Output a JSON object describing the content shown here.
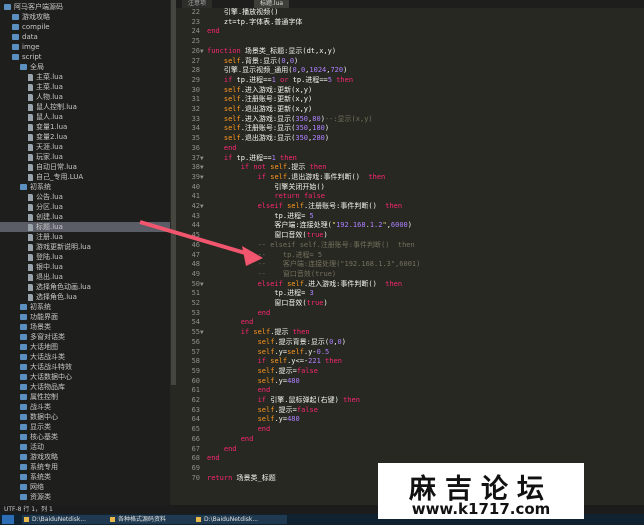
{
  "tabs": [
    "注意项",
    "标题.lua"
  ],
  "sidebar": {
    "items": [
      {
        "label": "阿马客户端源码",
        "type": "folder",
        "depth": 0
      },
      {
        "label": "游戏攻略",
        "type": "folder",
        "depth": 1
      },
      {
        "label": "compile",
        "type": "folder",
        "depth": 1
      },
      {
        "label": "data",
        "type": "folder",
        "depth": 1
      },
      {
        "label": "imge",
        "type": "folder",
        "depth": 1
      },
      {
        "label": "script",
        "type": "folder",
        "depth": 1
      },
      {
        "label": "全局",
        "type": "folder",
        "depth": 2
      },
      {
        "label": "主菜.lua",
        "type": "file",
        "depth": 3
      },
      {
        "label": "主菜.lua",
        "type": "file",
        "depth": 3
      },
      {
        "label": "人物.lua",
        "type": "file",
        "depth": 3
      },
      {
        "label": "鼠人控制.lua",
        "type": "file",
        "depth": 3
      },
      {
        "label": "鼠人.lua",
        "type": "file",
        "depth": 3
      },
      {
        "label": "变量1.lua",
        "type": "file",
        "depth": 3
      },
      {
        "label": "变量2.lua",
        "type": "file",
        "depth": 3
      },
      {
        "label": "天涯.lua",
        "type": "file",
        "depth": 3
      },
      {
        "label": "玩家.lua",
        "type": "file",
        "depth": 3
      },
      {
        "label": "自动日常.lua",
        "type": "file",
        "depth": 3
      },
      {
        "label": "自己_专用.LUA",
        "type": "file",
        "depth": 3
      },
      {
        "label": "初系统",
        "type": "folder",
        "depth": 2
      },
      {
        "label": "公告.lua",
        "type": "file",
        "depth": 3
      },
      {
        "label": "分区.lua",
        "type": "file",
        "depth": 3
      },
      {
        "label": "创建.lua",
        "type": "file",
        "depth": 3
      },
      {
        "label": "标题.lua",
        "type": "file",
        "depth": 3,
        "selected": true
      },
      {
        "label": "注册.lua",
        "type": "file",
        "depth": 3
      },
      {
        "label": "游戏更新说明.lua",
        "type": "file",
        "depth": 3
      },
      {
        "label": "登陆.lua",
        "type": "file",
        "depth": 3
      },
      {
        "label": "银中.lua",
        "type": "file",
        "depth": 3
      },
      {
        "label": "退出.lua",
        "type": "file",
        "depth": 3
      },
      {
        "label": "选择角色动画.lua",
        "type": "file",
        "depth": 3
      },
      {
        "label": "选择角色.lua",
        "type": "file",
        "depth": 3
      },
      {
        "label": "初系统",
        "type": "folder",
        "depth": 2
      },
      {
        "label": "功能界面",
        "type": "folder",
        "depth": 2
      },
      {
        "label": "场景类",
        "type": "folder",
        "depth": 2
      },
      {
        "label": "多窗对话类",
        "type": "folder",
        "depth": 2
      },
      {
        "label": "大话地图",
        "type": "folder",
        "depth": 2
      },
      {
        "label": "大话战斗类",
        "type": "folder",
        "depth": 2
      },
      {
        "label": "大话战斗特效",
        "type": "folder",
        "depth": 2
      },
      {
        "label": "大话数据中心",
        "type": "folder",
        "depth": 2
      },
      {
        "label": "大话物品库",
        "type": "folder",
        "depth": 2
      },
      {
        "label": "属性控制",
        "type": "folder",
        "depth": 2
      },
      {
        "label": "战斗类",
        "type": "folder",
        "depth": 2
      },
      {
        "label": "数据中心",
        "type": "folder",
        "depth": 2
      },
      {
        "label": "显示类",
        "type": "folder",
        "depth": 2
      },
      {
        "label": "核心基类",
        "type": "folder",
        "depth": 2
      },
      {
        "label": "活动",
        "type": "folder",
        "depth": 2
      },
      {
        "label": "游戏攻略",
        "type": "folder",
        "depth": 2
      },
      {
        "label": "系统专用",
        "type": "folder",
        "depth": 2
      },
      {
        "label": "系统类",
        "type": "folder",
        "depth": 2
      },
      {
        "label": "网络",
        "type": "folder",
        "depth": 2
      },
      {
        "label": "资源类",
        "type": "folder",
        "depth": 2
      }
    ]
  },
  "code": {
    "lines": [
      {
        "n": "22",
        "t": "    引擎.播放视频()"
      },
      {
        "n": "23",
        "t": "    zt=tp.字体表.普通字体"
      },
      {
        "n": "24",
        "t": "end"
      },
      {
        "n": "25",
        "t": ""
      },
      {
        "n": "26",
        "t": "function 场景类_标题:显示(dt,x,y)",
        "fold": true
      },
      {
        "n": "27",
        "t": "    self.背景:显示(0,0)"
      },
      {
        "n": "28",
        "t": "    引擎.显示视频_通用(0,0,1024,720)"
      },
      {
        "n": "29",
        "t": "    if tp.进程==1 or tp.进程==5 then"
      },
      {
        "n": "30",
        "t": "    self.进入游戏:更新(x,y)"
      },
      {
        "n": "31",
        "t": "    self.注册账号:更新(x,y)"
      },
      {
        "n": "32",
        "t": "    self.退出游戏:更新(x,y)"
      },
      {
        "n": "33",
        "t": "    self.进入游戏:显示(350,80)--:显示(x,y)"
      },
      {
        "n": "34",
        "t": "    self.注册账号:显示(350,180)"
      },
      {
        "n": "35",
        "t": "    self.退出游戏:显示(350,280)"
      },
      {
        "n": "36",
        "t": "    end"
      },
      {
        "n": "37",
        "t": "    if tp.进程==1 then",
        "fold": true
      },
      {
        "n": "38",
        "t": "        if not self.提示 then",
        "fold": true
      },
      {
        "n": "39",
        "t": "            if self.退出游戏:事件判断()  then",
        "fold": true
      },
      {
        "n": "40",
        "t": "                引擎关闭开始()"
      },
      {
        "n": "41",
        "t": "                return false"
      },
      {
        "n": "42",
        "t": "            elseif self.注册账号:事件判断()  then",
        "fold": true
      },
      {
        "n": "43",
        "t": "                tp.进程= 5"
      },
      {
        "n": "44",
        "t": "                客户端:连接处理(\"192.168.1.2\",6000)"
      },
      {
        "n": "45",
        "t": "                窗口音效(true)"
      },
      {
        "n": "46",
        "t": "            -- elseif self.注册账号:事件判断()  then"
      },
      {
        "n": "47",
        "t": "            --    tp.进程= 5"
      },
      {
        "n": "48",
        "t": "            --    客户端:连接处理(\"192.168.1.3\",6001)"
      },
      {
        "n": "49",
        "t": "            --    窗口音效(true)"
      },
      {
        "n": "50",
        "t": "            elseif self.进入游戏:事件判断()  then",
        "fold": true
      },
      {
        "n": "51",
        "t": "                tp.进程= 3"
      },
      {
        "n": "52",
        "t": "                窗口音效(true)"
      },
      {
        "n": "53",
        "t": "            end"
      },
      {
        "n": "54",
        "t": "        end"
      },
      {
        "n": "55",
        "t": "        if self.提示 then",
        "fold": true
      },
      {
        "n": "56",
        "t": "            self.提示背景:显示(0,0)"
      },
      {
        "n": "57",
        "t": "            self.y=self.y-0.5"
      },
      {
        "n": "58",
        "t": "            if self.y<=-221 then"
      },
      {
        "n": "59",
        "t": "            self.提示=false"
      },
      {
        "n": "60",
        "t": "            self.y=480"
      },
      {
        "n": "61",
        "t": "            end"
      },
      {
        "n": "62",
        "t": "            if 引擎.鼠标弹起(右键) then"
      },
      {
        "n": "63",
        "t": "            self.提示=false"
      },
      {
        "n": "64",
        "t": "            self.y=480"
      },
      {
        "n": "65",
        "t": "            end"
      },
      {
        "n": "66",
        "t": "        end"
      },
      {
        "n": "67",
        "t": "    end"
      },
      {
        "n": "68",
        "t": "end"
      },
      {
        "n": "69",
        "t": ""
      },
      {
        "n": "70",
        "t": "return 场景类_标题"
      }
    ]
  },
  "status": {
    "text": "UTF-8 行 1，列 1"
  },
  "taskbar": {
    "items": [
      "D:\\BaiduNetdisk...",
      "各种格式源码资料",
      "D:\\BaiduNetdisk..."
    ]
  },
  "watermark": {
    "title": "麻吉论坛",
    "url": "www.k1717.com"
  },
  "colors": {
    "accent_arrow": "#f2566e",
    "editor_bg": "#272822",
    "sidebar_bg": "#1e1f1c"
  }
}
